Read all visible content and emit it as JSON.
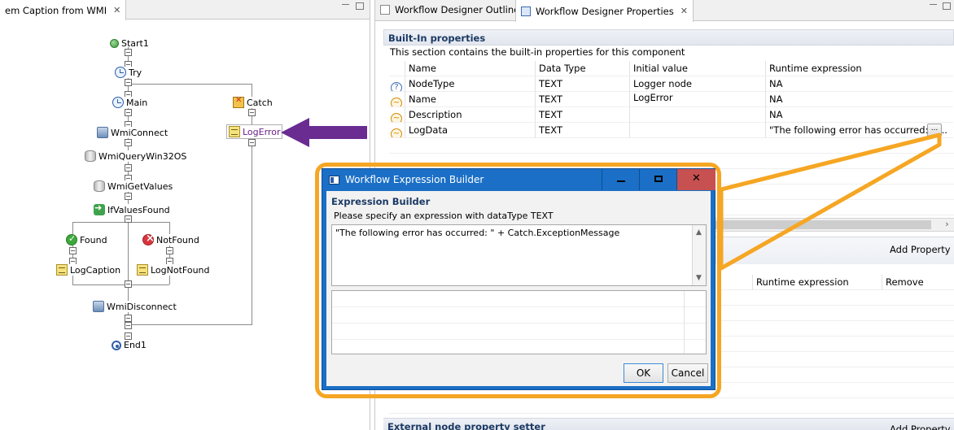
{
  "left": {
    "tab_title": "em Caption from WMI",
    "nodes": {
      "start": "Start1",
      "try": "Try",
      "main": "Main",
      "catch": "Catch",
      "wmi_connect": "WmiConnect",
      "log_error": "LogError",
      "wmi_query": "WmiQueryWin32OS",
      "wmi_get_values": "WmiGetValues",
      "if_values_found": "IfValuesFound",
      "found": "Found",
      "not_found": "NotFound",
      "log_caption": "LogCaption",
      "log_not_found": "LogNotFound",
      "wmi_disconnect": "WmiDisconnect",
      "end": "End1"
    }
  },
  "right": {
    "tabs": [
      "Workflow Designer Outline",
      "Workflow Designer Properties"
    ],
    "builtin": {
      "title": "Built-In properties",
      "desc": "This section contains the built-in properties for this component",
      "columns": [
        "Name",
        "Data Type",
        "Initial value",
        "Runtime expression"
      ],
      "rows": [
        {
          "name": "NodeType",
          "type": "TEXT",
          "initial": "Logger node",
          "runtime": "NA",
          "icon": "question-icon"
        },
        {
          "name": "Name",
          "type": "TEXT",
          "initial": "LogError",
          "runtime": "NA",
          "icon": "expression-icon"
        },
        {
          "name": "Description",
          "type": "TEXT",
          "initial": "",
          "runtime": "NA",
          "icon": "expression-icon"
        },
        {
          "name": "LogData",
          "type": "TEXT",
          "initial": "",
          "runtime": "\"The following error has occurred: \" ...",
          "icon": "expression-icon"
        }
      ],
      "ellipsis": "..."
    },
    "custom": {
      "add_property": "Add Property",
      "columns": [
        "Runtime expression",
        "Remove"
      ]
    },
    "external": {
      "title": "External node property setter",
      "add_property": "Add Property"
    }
  },
  "dialog": {
    "title": "Workflow Expression Builder",
    "section": "Expression Builder",
    "instruction": "Please specify an expression with dataType TEXT",
    "expression": "\"The following error has occurred: \" + Catch.ExceptionMessage",
    "ok": "OK",
    "cancel": "Cancel"
  },
  "colors": {
    "annotation_arrow": "#6a2c91",
    "highlight_outline": "#f5a623",
    "dialog_titlebar": "#1b6fc6",
    "close_button": "#c75050"
  }
}
